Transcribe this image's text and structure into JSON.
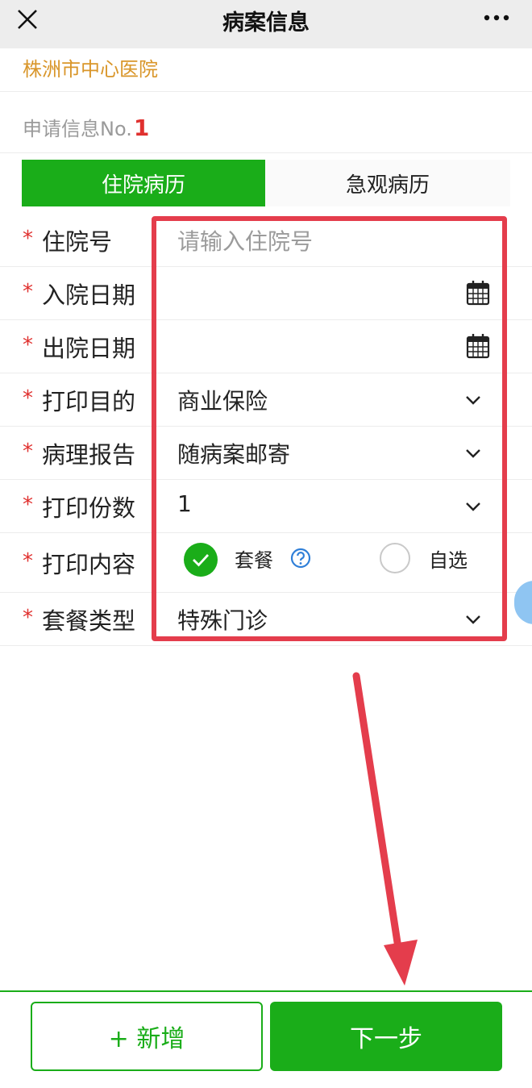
{
  "header": {
    "title": "病案信息",
    "close_icon": "close-icon",
    "more_icon": "more-icon"
  },
  "hospital_name": "株洲市中心医院",
  "application": {
    "label": "申请信息No.",
    "number": "1"
  },
  "tabs": [
    {
      "label": "住院病历",
      "active": true
    },
    {
      "label": "急观病历",
      "active": false
    }
  ],
  "form": {
    "required_mark": "*",
    "admission_no": {
      "label": "住院号",
      "placeholder": "请输入住院号"
    },
    "admit_date": {
      "label": "入院日期",
      "value": ""
    },
    "discharge_date": {
      "label": "出院日期",
      "value": ""
    },
    "print_purpose": {
      "label": "打印目的",
      "value": "商业保险"
    },
    "pathology_report": {
      "label": "病理报告",
      "value": "随病案邮寄"
    },
    "print_copies": {
      "label": "打印份数",
      "value": "1"
    },
    "print_content": {
      "label": "打印内容",
      "option_package": "套餐",
      "option_custom": "自选",
      "selected": "套餐"
    },
    "package_type": {
      "label": "套餐类型",
      "value": "特殊门诊"
    }
  },
  "buttons": {
    "add_label": "+ 新增",
    "next_label": "下一步"
  },
  "colors": {
    "primary_green": "#1aad19",
    "hospital_orange": "#d9962a",
    "required_red": "#e0312f",
    "annotation_red": "#e43d4c"
  }
}
